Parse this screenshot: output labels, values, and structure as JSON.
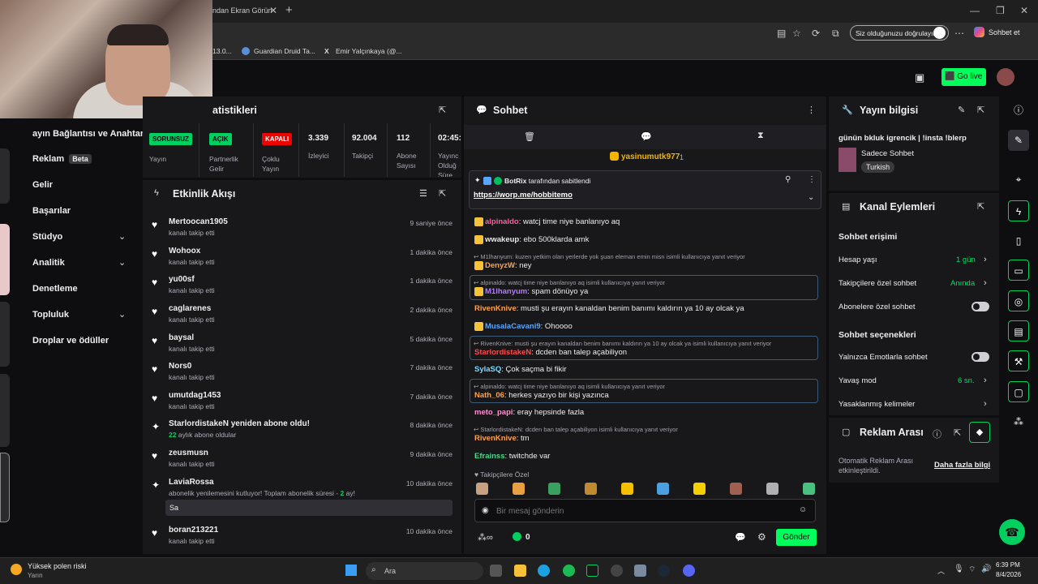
{
  "browser": {
    "tab_title": "ndan Ekran Görün",
    "signin_pill": "Siz olduğunuzu doğrulayın",
    "copilot": "Sohbet et",
    "bookmarks": [
      "13.0...",
      "Guardian Druid Ta...",
      "Emir Yalçınkaya (@..."
    ]
  },
  "appbar": {
    "go_live": "Go live"
  },
  "nav": {
    "items": [
      {
        "label": "ayın Bağlantısı ve Anahtarı"
      },
      {
        "label": "Reklam",
        "badge": "Beta"
      },
      {
        "label": "Gelir"
      },
      {
        "label": "Başarılar"
      },
      {
        "label": "Stüdyo"
      },
      {
        "label": "Analitik"
      },
      {
        "label": "Denetleme"
      },
      {
        "label": "Topluluk"
      },
      {
        "label": "Droplar ve ödüller"
      }
    ]
  },
  "stats": {
    "title": "atistikleri",
    "cols": [
      {
        "badge": "SORUNSUZ",
        "label": "Yayın"
      },
      {
        "badge": "AÇIK",
        "label": "Partnerlik Gelir"
      },
      {
        "badge": "KAPALI",
        "label": "Çoklu Yayın"
      },
      {
        "value": "3.339",
        "label": "İzleyici"
      },
      {
        "value": "92.004",
        "label": "Takipçi"
      },
      {
        "value": "112",
        "label": "Abone Sayısı"
      },
      {
        "value": "02:45:",
        "label": "Yayınc Olduğ Süre"
      }
    ]
  },
  "feed": {
    "title": "Etkinlik Akışı",
    "items": [
      {
        "name": "Mertoocan1905",
        "sub": "kanalı takip etti",
        "time": "9 saniye önce"
      },
      {
        "name": "Wohoox",
        "sub": "kanalı takip etti",
        "time": "1 dakika önce"
      },
      {
        "name": "yu00sf",
        "sub": "kanalı takip etti",
        "time": "1 dakika önce"
      },
      {
        "name": "caglarenes",
        "sub": "kanalı takip etti",
        "time": "2 dakika önce"
      },
      {
        "name": "baysal",
        "sub": "kanalı takip etti",
        "time": "5 dakika önce"
      },
      {
        "name": "Nors0",
        "sub": "kanalı takip etti",
        "time": "7 dakika önce"
      },
      {
        "name": "umutdag1453",
        "sub": "kanalı takip etti",
        "time": "7 dakika önce"
      },
      {
        "name": "StarlordistakeN yeniden abone oldu!",
        "sub_num": "22",
        "sub": "aylık abone oldular",
        "time": "8 dakika önce"
      },
      {
        "name": "zeusmusn",
        "sub": "kanalı takip etti",
        "time": "9 dakika önce"
      },
      {
        "name": "LaviaRossa",
        "sub": "abonelik yenilemesini kutluyor! Toplam abonelik süresi - ",
        "sub_num": "2",
        "sub_tail": " ay!",
        "time": "10 dakika önce",
        "msg": "Sa"
      },
      {
        "name": "boran213221",
        "sub": "kanalı takip etti",
        "time": "10 dakika önce"
      }
    ]
  },
  "chat": {
    "title": "Sohbet",
    "top_user": "yasinumutk977",
    "top_count": "1",
    "pinned_by": "BotRix",
    "pinned_suffix": "tarafından sabitlendi",
    "pinned_link": "https://worp.me/hobbitemo",
    "messages": [
      {
        "user": "alpinaldo",
        "text": ": watcj time niye banlanıyo aq",
        "color": "#ff5fa0",
        "badge": "13"
      },
      {
        "user": "wwakeup",
        "text": ": ebo 500klarda amk",
        "color": "#eaeaea",
        "badge": "32"
      },
      {
        "hint": "M1lhanyum: kuzen yetkim olan yerlerde yok şuan eleman emin misn isimli kullanıcıya yanıt veriyor"
      },
      {
        "user": "DenyzW",
        "text": ": ney",
        "color": "#ffa14a",
        "badge": "21"
      },
      {
        "hint": "alpinaldo: watcj time niye banlanıyo aq isimli kullanıcıya yanıt veriyor",
        "box": true
      },
      {
        "user": "M1lhanyum",
        "text": ": spam dönüyo ya",
        "color": "#b67aff",
        "badge": "34",
        "box": true
      },
      {
        "user": "RivenKnive",
        "text": ": musti şu erayın kanaldan benim banımı kaldırın ya 10 ay olcak ya",
        "color": "#ffa14a"
      },
      {
        "user": "MusalaCavani9",
        "text": ": Ohoooo",
        "color": "#58a6ff",
        "badge": "21"
      },
      {
        "hint": "RivenKnive: musti şu erayın kanaldan benim banımı kaldırın ya 10 ay olcak ya isimli kullanıcıya yanıt veriyor",
        "box": true
      },
      {
        "user": "StarlordistakeN",
        "text": ": dcden ban talep açabiliyon",
        "color": "#ff4a4a",
        "box": true
      },
      {
        "user": "SylaSQ",
        "text": ": Çok saçma bi fikir",
        "color": "#7bd9ff"
      },
      {
        "hint": "alpinaldo: watcj time niye banlanıyo aq isimli kullanıcıya yanıt veriyor",
        "box": true
      },
      {
        "user": "Nath_06",
        "text": ": herkes yazıyo bir kişi yazınca",
        "color": "#ffa14a",
        "box": true
      },
      {
        "user": "meto_papi",
        "text": ": eray hepsinde fazla",
        "color": "#ff8fd0"
      },
      {
        "hint": "StarlordistakeN: dcden ban talep açabiliyon isimli kullanıcıya yanıt veriyor"
      },
      {
        "user": "RivenKnive",
        "text": ": tm",
        "color": "#ffa14a"
      },
      {
        "user": "Efrainss",
        "text": ": twitchde var",
        "color": "#4ad98a"
      }
    ],
    "followers_only": "Takipçilere Özel",
    "input_placeholder": "Bir mesaj gönderin",
    "points": "0",
    "send": "Gönder"
  },
  "stream_info": {
    "title": "Yayın bilgisi",
    "stream_title": "günün bkluk igrencik | !insta !blerp",
    "category": "Sadece Sohbet",
    "tag": "Turkish"
  },
  "channel_actions": {
    "title": "Kanal Eylemleri",
    "chat_access": "Sohbet erişimi",
    "rows": [
      {
        "label": "Hesap yaşı",
        "value": "1 gün"
      },
      {
        "label": "Takipçilere özel sohbet",
        "value": "Anında"
      },
      {
        "label": "Abonelere özel sohbet",
        "toggle": true
      }
    ],
    "chat_options": "Sohbet seçenekleri",
    "rows2": [
      {
        "label": "Yalnızca Emotlarla sohbet",
        "toggle": true
      },
      {
        "label": "Yavaş mod",
        "value": "6 sn."
      },
      {
        "label": "Yasaklanmış kelimeler"
      }
    ]
  },
  "ad_break": {
    "title": "Reklam Arası",
    "desc": "Otomatik Reklam Arası etkinleştirildi.",
    "link": "Daha fazla bilgi"
  },
  "taskbar": {
    "weather_title": "Yüksek polen riski",
    "weather_sub": "Yarın",
    "search": "Ara",
    "time": "6:39 PM",
    "date": "8/4/2026"
  },
  "colors": {
    "accent_green": "#00ff5a",
    "twitch_bg": "#0e0e10",
    "panel": "#18181b"
  }
}
